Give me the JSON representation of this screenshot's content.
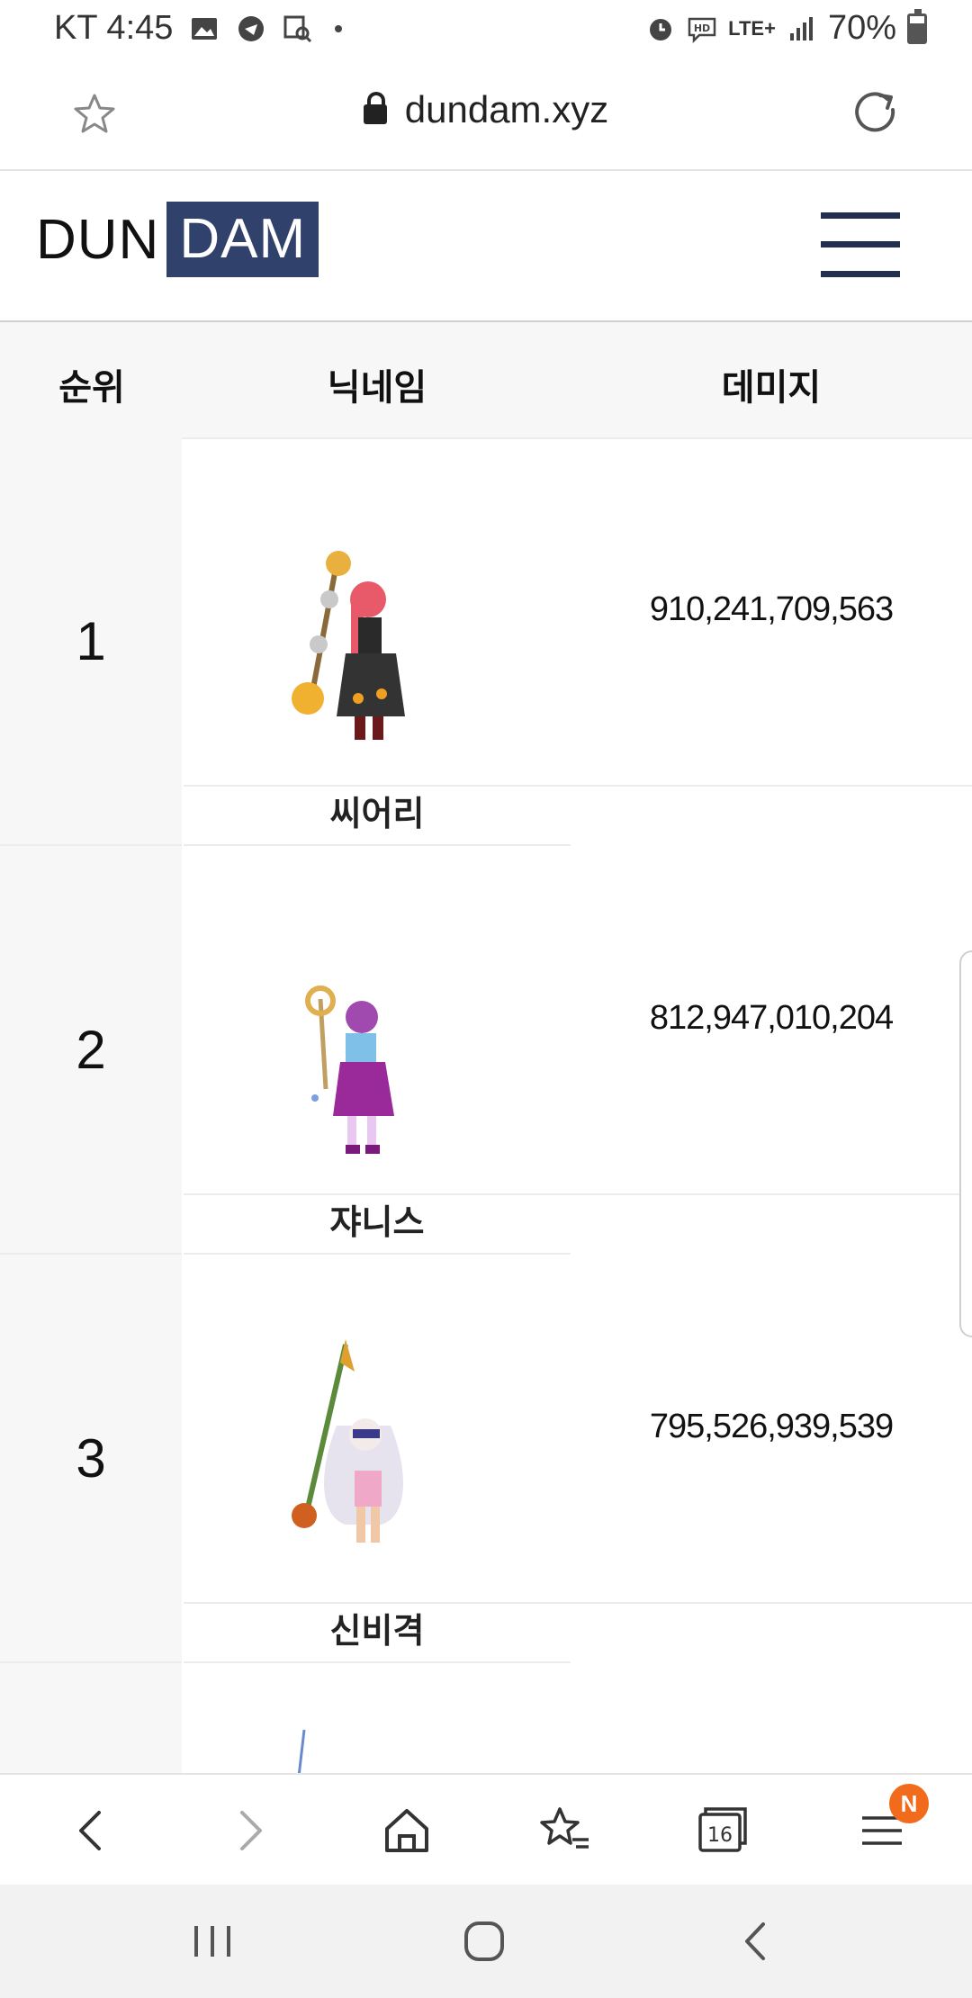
{
  "status_bar": {
    "carrier_time": "KT 4:45",
    "network": "LTE+",
    "battery": "70%"
  },
  "browser": {
    "url": "dundam.xyz",
    "tab_count": "16",
    "menu_badge": "N"
  },
  "site": {
    "logo_part1": "DUN",
    "logo_part2": "DAM",
    "accent_color": "#30426b"
  },
  "table": {
    "headers": {
      "rank": "순위",
      "nickname": "닉네임",
      "damage": "데미지"
    },
    "rows": [
      {
        "rank": "1",
        "name": "씨어리",
        "damage": "910,241,709,563"
      },
      {
        "rank": "2",
        "name": "쟈니스",
        "damage": "812,947,010,204"
      },
      {
        "rank": "3",
        "name": "신비격",
        "damage": "795,526,939,539"
      }
    ]
  },
  "icons": {
    "status": [
      "gallery-icon",
      "app-icon",
      "search-icon",
      "alarm-icon",
      "hd-voice-icon",
      "signal-icon",
      "battery-icon"
    ],
    "browser": [
      "bookmark-star-icon",
      "lock-icon",
      "reload-icon",
      "back-icon",
      "forward-icon",
      "home-icon",
      "bookmarks-icon",
      "tabs-icon",
      "menu-icon"
    ],
    "nav": [
      "recents-icon",
      "home-circle-icon",
      "back-chevron-icon"
    ]
  }
}
